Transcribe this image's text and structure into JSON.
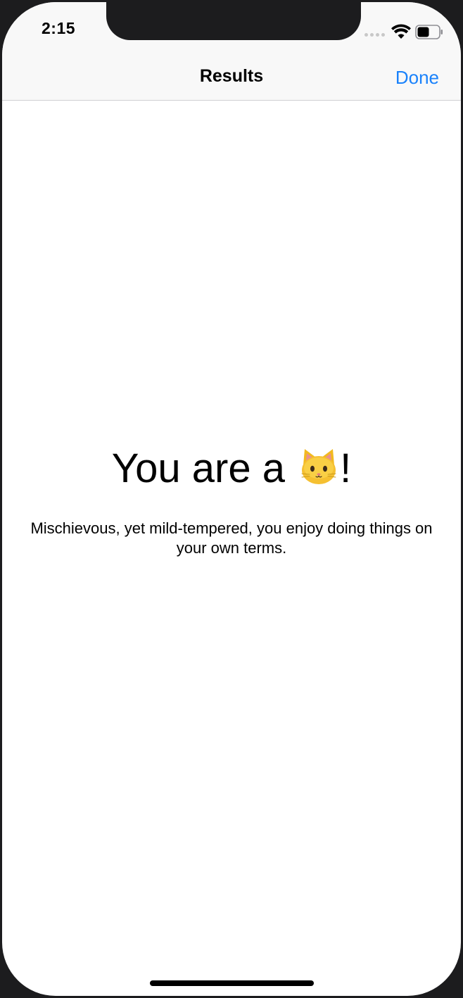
{
  "status_bar": {
    "time": "2:15",
    "signal_icon": "cellular-signal-icon",
    "wifi_icon": "wifi-icon",
    "battery_icon": "battery-icon",
    "battery_level": 0.55
  },
  "nav": {
    "title": "Results",
    "done_label": "Done",
    "accent_color": "#1a82fb"
  },
  "result": {
    "heading_prefix": "You are a ",
    "animal_icon": "cat-face-icon",
    "heading_suffix": "!",
    "description": "Mischievous, yet mild-tempered, you enjoy doing things on your own terms."
  }
}
